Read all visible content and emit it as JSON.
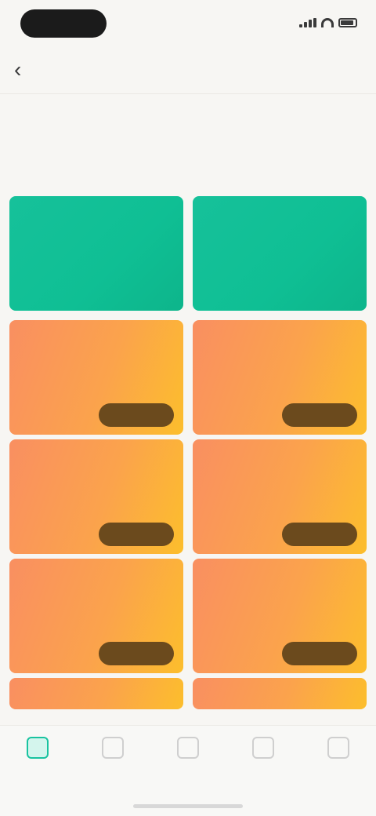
{
  "status_bar": {
    "time": ""
  },
  "nav": {
    "title": ""
  },
  "banner": {
    "text": "",
    "sub": ""
  },
  "colors": {
    "accent": "#19c3a0",
    "card_green": "#0fbf94",
    "card_orange_start": "#f98f61",
    "card_orange_end": "#fcbe2c",
    "banner_text": "#f1a95a"
  },
  "cards": [
    {
      "style": "green",
      "title": "",
      "desc": "",
      "foot": "",
      "button": ""
    },
    {
      "style": "green",
      "title": "",
      "desc": "",
      "foot": "",
      "button": ""
    },
    {
      "style": "orange",
      "title": "",
      "desc": "",
      "foot": "",
      "button": ""
    },
    {
      "style": "orange",
      "title": "",
      "desc": "",
      "foot": "",
      "button": ""
    },
    {
      "style": "orange",
      "title": "",
      "desc": "",
      "foot": "",
      "button": ""
    },
    {
      "style": "orange",
      "title": "",
      "desc": "",
      "foot": "",
      "button": ""
    },
    {
      "style": "orange",
      "title": "",
      "desc": "",
      "foot": "",
      "button": ""
    },
    {
      "style": "orange",
      "title": "",
      "desc": "",
      "foot": "",
      "button": ""
    },
    {
      "style": "orange",
      "title": "",
      "desc": "",
      "foot": "",
      "button": ""
    },
    {
      "style": "orange",
      "title": "",
      "desc": "",
      "foot": "",
      "button": ""
    }
  ],
  "tab_bar": {
    "tabs": [
      {
        "label": "",
        "icon": "home-icon",
        "active": true
      },
      {
        "label": "",
        "icon": "grid-icon",
        "active": false
      },
      {
        "label": "",
        "icon": "card-icon",
        "active": false
      },
      {
        "label": "",
        "icon": "message-icon",
        "active": false
      },
      {
        "label": "",
        "icon": "user-icon",
        "active": false
      }
    ]
  }
}
